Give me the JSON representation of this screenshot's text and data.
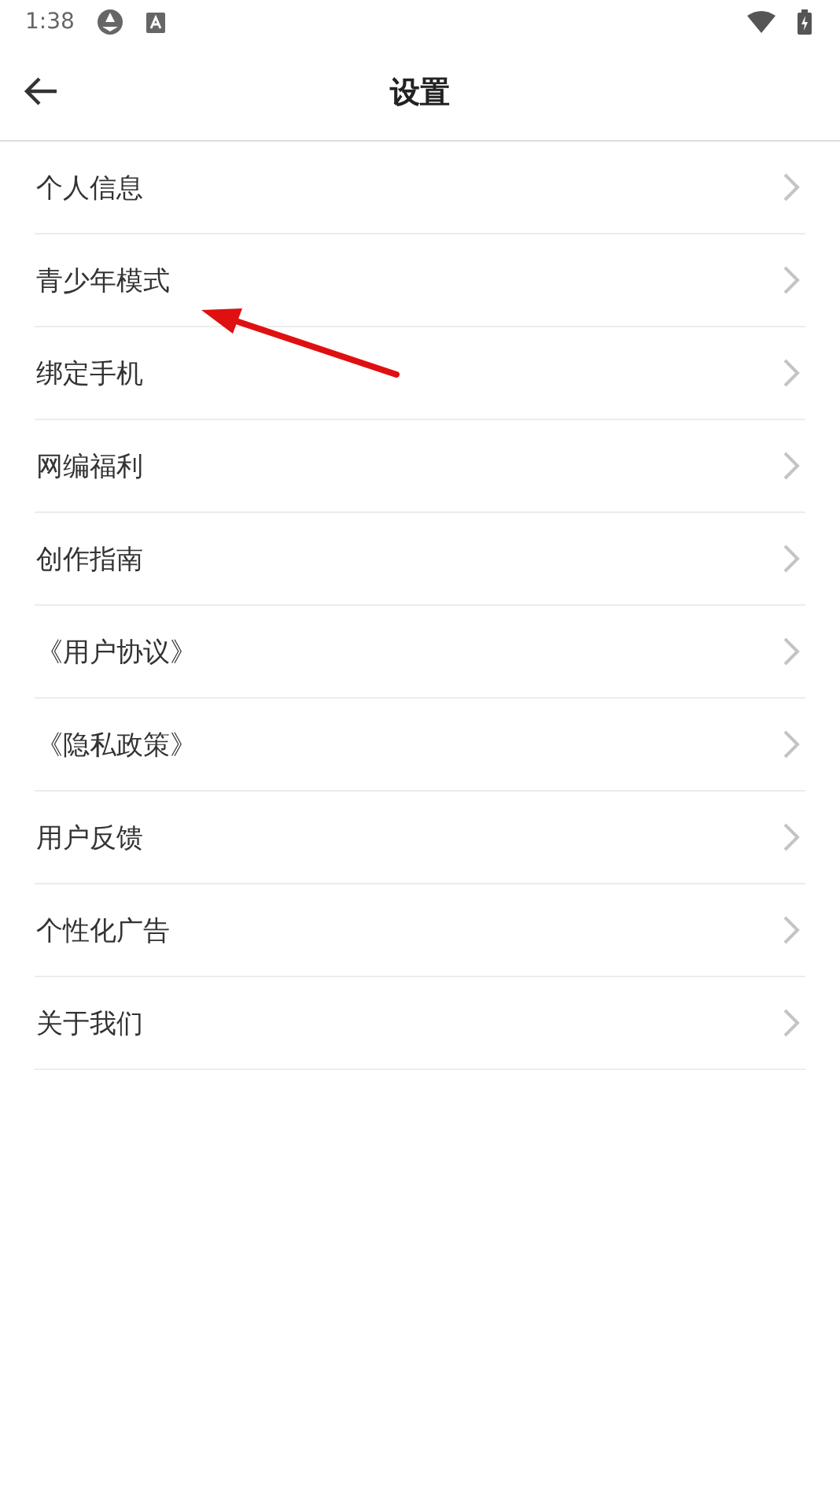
{
  "status_bar": {
    "time": "1:38"
  },
  "header": {
    "title": "设置"
  },
  "items": [
    {
      "label": "个人信息"
    },
    {
      "label": "青少年模式"
    },
    {
      "label": "绑定手机"
    },
    {
      "label": "网编福利"
    },
    {
      "label": "创作指南"
    },
    {
      "label": "《用户协议》"
    },
    {
      "label": "《隐私政策》"
    },
    {
      "label": "用户反馈"
    },
    {
      "label": "个性化广告"
    },
    {
      "label": "关于我们"
    }
  ]
}
